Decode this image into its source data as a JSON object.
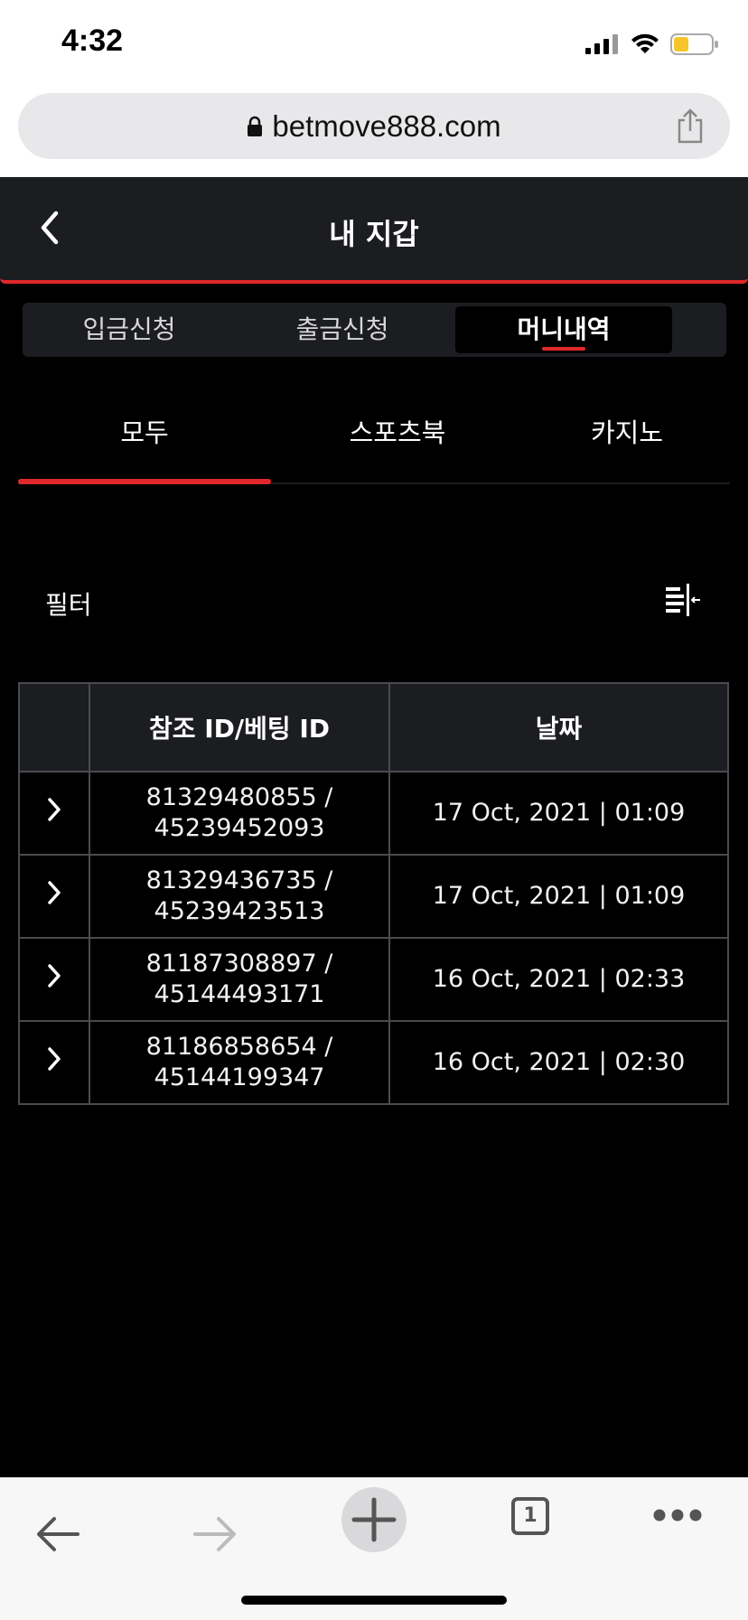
{
  "status": {
    "time": "4:32"
  },
  "browser": {
    "url": "betmove888.com",
    "tab_count": "1"
  },
  "header": {
    "title": "내 지갑"
  },
  "segments": [
    "입금신청",
    "출금신청",
    "머니내역"
  ],
  "subtabs": [
    "모두",
    "스포츠북",
    "카지노"
  ],
  "filter": {
    "label": "필터"
  },
  "table": {
    "headers": [
      "참조 ID/베팅 ID",
      "날짜"
    ],
    "rows": [
      {
        "ref": "81329480855 /",
        "bet": "45239452093",
        "date": "17 Oct, 2021 | 01:09"
      },
      {
        "ref": "81329436735 /",
        "bet": "45239423513",
        "date": "17 Oct, 2021 | 01:09"
      },
      {
        "ref": "81187308897 /",
        "bet": "45144493171",
        "date": "16 Oct, 2021 | 02:33"
      },
      {
        "ref": "81186858654 /",
        "bet": "45144199347",
        "date": "16 Oct, 2021 | 02:30"
      }
    ]
  },
  "colors": {
    "accent": "#e0282a",
    "panel": "#1c1d21",
    "background": "#000000"
  }
}
